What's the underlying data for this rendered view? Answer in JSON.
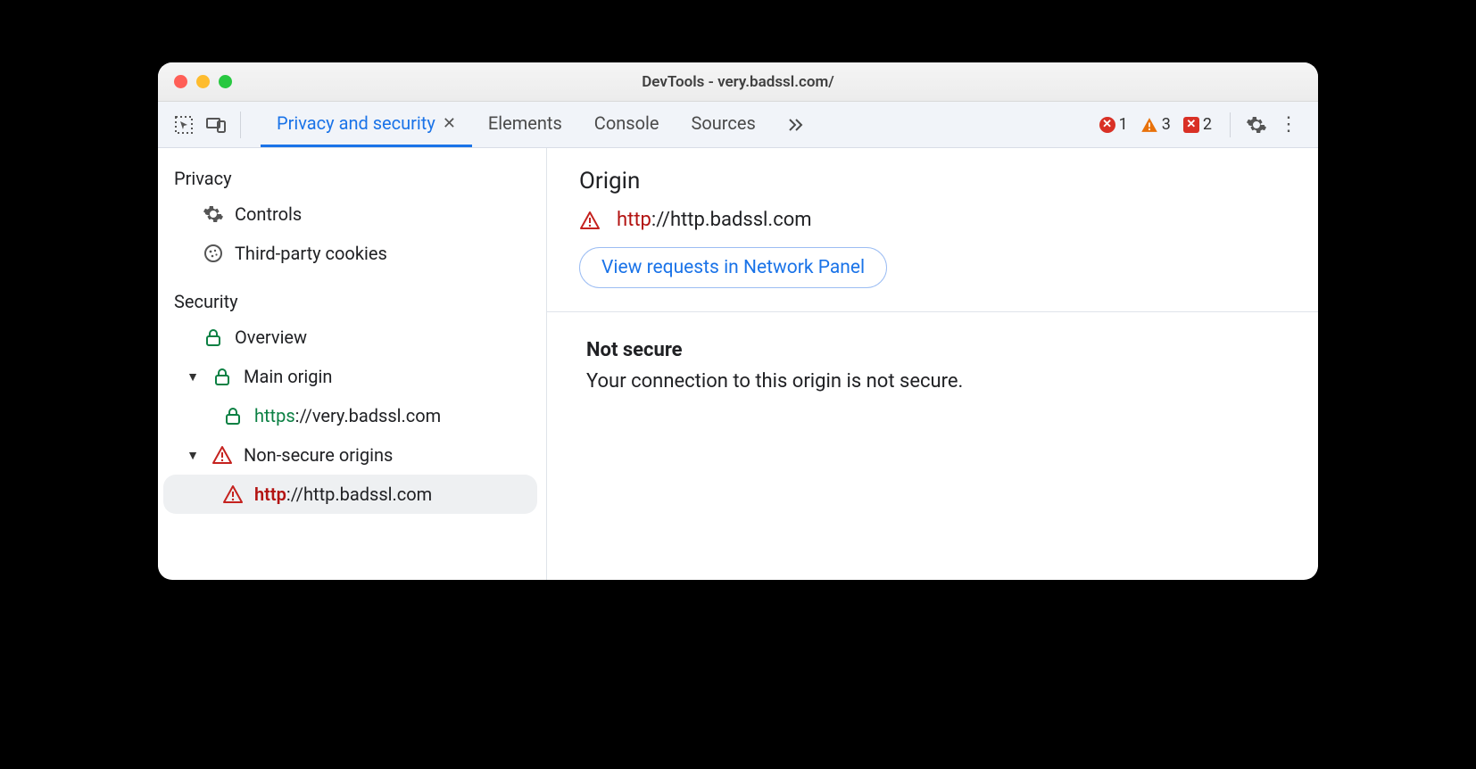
{
  "window": {
    "title": "DevTools - very.badssl.com/"
  },
  "tabs": {
    "active": "Privacy and security",
    "items": [
      "Privacy and security",
      "Elements",
      "Console",
      "Sources"
    ]
  },
  "counters": {
    "errors": 1,
    "warnings": 3,
    "messages": 2
  },
  "sidebar": {
    "privacy": {
      "title": "Privacy",
      "controls": "Controls",
      "third_party": "Third-party cookies"
    },
    "security": {
      "title": "Security",
      "overview": "Overview",
      "main_origin_label": "Main origin",
      "main_origin": {
        "scheme": "https",
        "rest": "://very.badssl.com"
      },
      "nonsecure_label": "Non-secure origins",
      "nonsecure_origin": {
        "scheme": "http",
        "rest": "://http.badssl.com"
      }
    }
  },
  "main": {
    "origin_title": "Origin",
    "origin": {
      "scheme": "http",
      "rest": "://http.badssl.com"
    },
    "view_requests": "View requests in Network Panel",
    "status_title": "Not secure",
    "status_body": "Your connection to this origin is not secure."
  }
}
